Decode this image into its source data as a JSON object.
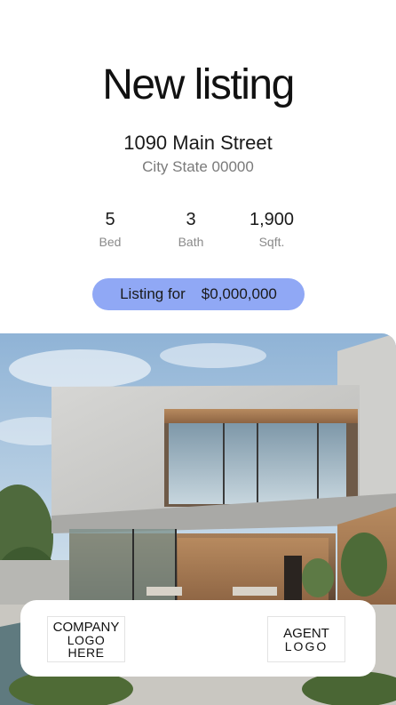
{
  "title": "New listing",
  "address": {
    "street": "1090 Main Street",
    "city_state_zip": "City State 00000"
  },
  "stats": {
    "bed": {
      "value": "5",
      "label": "Bed"
    },
    "bath": {
      "value": "3",
      "label": "Bath"
    },
    "sqft": {
      "value": "1,900",
      "label": "Sqft."
    }
  },
  "price": {
    "label": "Listing for",
    "value": "$0,000,000"
  },
  "logos": {
    "company_line1": "COMPANY",
    "company_line2": "LOGO HERE",
    "agent_line1": "AGENT",
    "agent_line2": "LOGO"
  },
  "colors": {
    "accent_pill": "#90a8f5",
    "background": "#ffffff"
  }
}
